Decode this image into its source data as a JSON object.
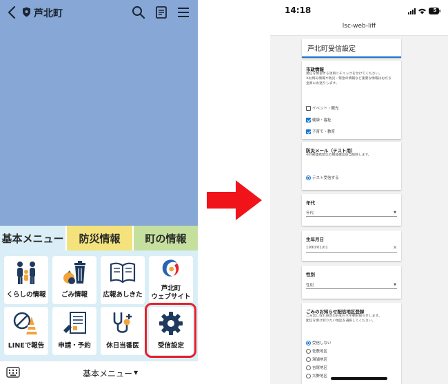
{
  "line_screen": {
    "account_name": "芦北町",
    "tabs": [
      {
        "label": "基本メニュー"
      },
      {
        "label": "防災情報"
      },
      {
        "label": "町の情報"
      }
    ],
    "tiles": [
      {
        "label": "くらしの情報",
        "icon": "family-icon"
      },
      {
        "label": "ごみ情報",
        "icon": "trash-icon"
      },
      {
        "label": "広報あしきた",
        "icon": "book-icon"
      },
      {
        "label_l1": "芦北町",
        "label_l2": "ウェブサイト",
        "icon": "town-logo-icon"
      },
      {
        "label": "LINEで報告",
        "icon": "report-icon"
      },
      {
        "label": "申請・予約",
        "icon": "form-icon"
      },
      {
        "label": "休日当番医",
        "icon": "stethoscope-icon"
      },
      {
        "label": "受信設定",
        "icon": "gear-icon"
      }
    ],
    "bottom_menu_label": "基本メニュー",
    "colors": {
      "background": "#87a7d6",
      "highlight": "#e8202a",
      "tab2": "#f4e37c",
      "tab3": "#c5e09e"
    }
  },
  "liff_screen": {
    "time": "14:18",
    "battery": "5",
    "url": "lsc-web-liff",
    "page_title": "芦北町受信設定",
    "municipal": {
      "heading": "市政情報",
      "desc_l1": "受信を希望する項目にチェックを付けてください。",
      "desc_l2": "※お悔み情報や防災・緊急の情報など重要な情報はおだち",
      "desc_l3": "全員にお送りします。",
      "options": [
        {
          "label": "イベント・観光",
          "checked": false
        },
        {
          "label": "健康・福祉",
          "checked": true
        },
        {
          "label": "子育て・教育",
          "checked": true
        }
      ]
    },
    "disaster": {
      "heading": "防災メール（テスト用）",
      "desc": "※外部連携配信の機能確認該当削除します。",
      "option": "テスト受信する"
    },
    "age": {
      "heading": "年代",
      "value": "年代"
    },
    "birthday": {
      "heading": "生年月日",
      "value": "1990/01/01"
    },
    "gender": {
      "heading": "性別",
      "value": "性別"
    },
    "garbage": {
      "heading": "ごみのお知らせ配信地区登録",
      "desc_l1": "ごみ出し収れ訳定のお知らせを朝お知らせします。",
      "desc_l2": "配信を受け取りたい地区を選択してください。",
      "options": [
        {
          "label": "受信しない",
          "selected": true
        },
        {
          "label": "佐敷地区",
          "selected": false
        },
        {
          "label": "湯浦地区",
          "selected": false
        },
        {
          "label": "吉尾地区",
          "selected": false
        },
        {
          "label": "大野地区",
          "selected": false
        }
      ]
    },
    "accent_color": "#1976d2"
  }
}
